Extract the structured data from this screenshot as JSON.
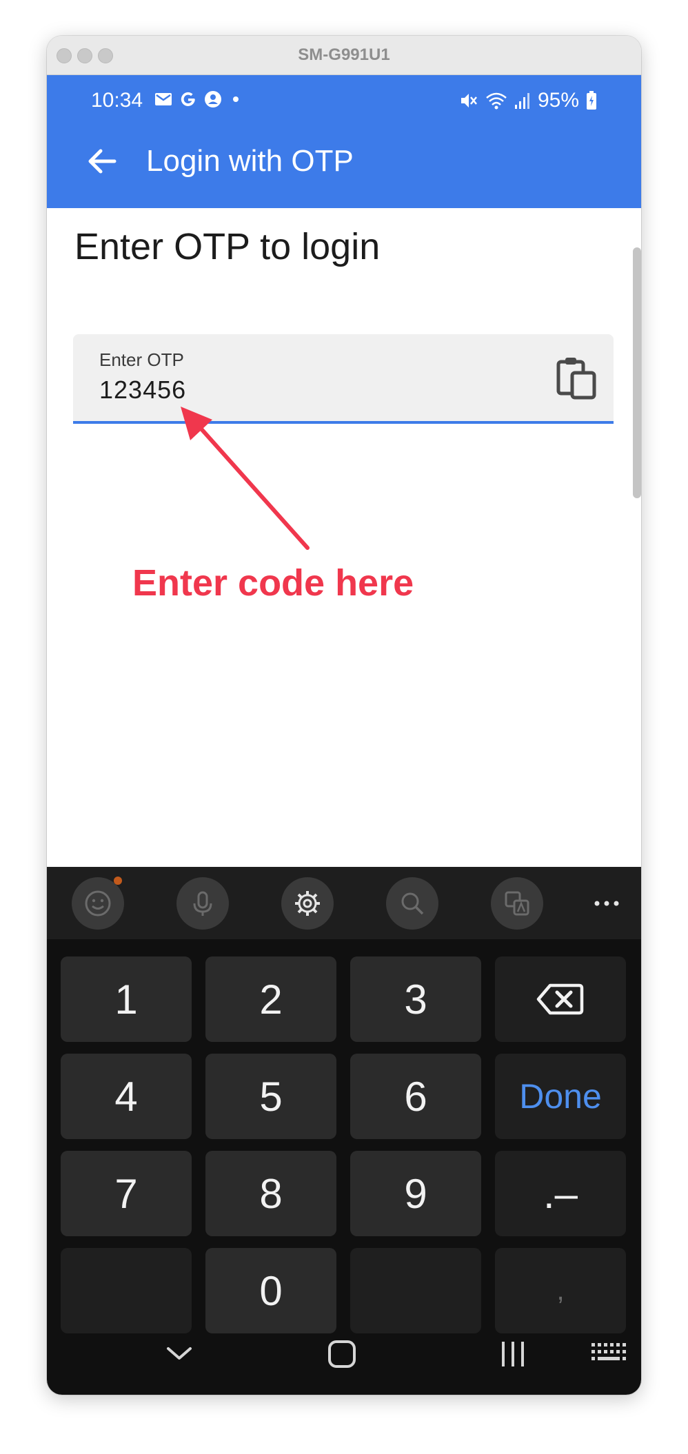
{
  "window": {
    "title": "SM-G991U1"
  },
  "status_bar": {
    "time": "10:34",
    "left_icons": [
      "mail-icon",
      "google-icon",
      "account-icon",
      "dot-icon"
    ],
    "right_icons": [
      "mute-icon",
      "wifi-icon",
      "signal-icon",
      "battery-icon"
    ],
    "battery": "95%"
  },
  "app_bar": {
    "title": "Login with OTP",
    "back_icon": "back-arrow-icon",
    "color": "#3d7be9"
  },
  "content": {
    "heading": "Enter OTP to login",
    "otp_field": {
      "label": "Enter OTP",
      "value": "123456",
      "trailing_icon": "paste-icon"
    },
    "annotation": {
      "text": "Enter code here",
      "color": "#f0374d"
    }
  },
  "keyboard": {
    "toolbar": [
      "emoji-icon",
      "microphone-icon",
      "settings-icon",
      "search-icon",
      "translate-icon",
      "more-icon"
    ],
    "rows": [
      [
        "1",
        "2",
        "3",
        "backspace"
      ],
      [
        "4",
        "5",
        "6",
        "Done"
      ],
      [
        "7",
        "8",
        "9",
        ".–"
      ],
      [
        "",
        "0",
        "",
        ","
      ]
    ],
    "done_label": "Done",
    "accent": "#4e8fee"
  },
  "nav_bar": [
    "hide-keyboard-icon",
    "home-icon",
    "recents-icon",
    "keyboard-switch-icon"
  ]
}
